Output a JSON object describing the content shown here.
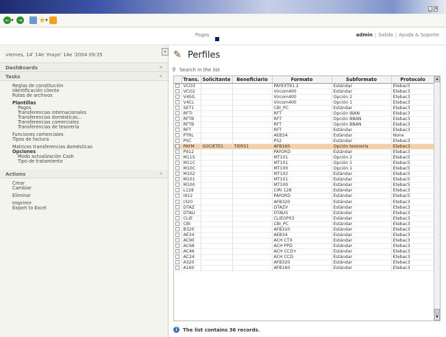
{
  "window": {
    "controls": [
      "_",
      "×"
    ]
  },
  "toolbar": {
    "icons": [
      "back-icon",
      "forward-icon",
      "page-icon",
      "favorites-star-icon",
      "home-icon"
    ]
  },
  "header": {
    "nav_item": "Pagos",
    "user": "admin",
    "links": [
      "Salida",
      "Ayuda & Soporte"
    ]
  },
  "sidebar": {
    "date": "viernes, 14' 14e 'mayo' 14e '2004 09:35",
    "collapse_label": "«",
    "dashboards_title": "DashBoards",
    "tasks_title": "Tasks",
    "tasks": {
      "reglas": "Reglas de constitución",
      "identificacion": "Identificación cliente",
      "rutas": "Rutas de archivos",
      "plantillas": "Plantillas",
      "pagos": "Pagos",
      "transf_int": "Transferencias internacionales",
      "transf_dom": "Transferencias domésticas...",
      "transf_com": "Transferencias comerciales",
      "transf_tes": "Transferencias de tesorería",
      "funciones": "Funciones comerciales",
      "tipos_factura": "Tipos de factura",
      "matrices": "Matrices transferencias domésticas",
      "opciones": "Opciones",
      "modo_cash": "Modo actualización Cash",
      "tipo_tratamiento": "Tipo de tratamiento"
    },
    "actions_title": "Actions",
    "actions": {
      "crear": "Crear",
      "cambiar": "Cambiar",
      "eliminar": "Eliminar",
      "imprimir": "Imprimir",
      "export": "Export to Excel"
    }
  },
  "main": {
    "title": "Perfiles",
    "search_label": "Search in the list",
    "columns": [
      "Trans.",
      "Solicitante",
      "Beneficiario",
      "Formato",
      "Subformato",
      "Protocolo"
    ],
    "rows": [
      [
        "VCO3",
        "",
        "",
        "PAYEXT91.2",
        "Estándar",
        "Etebac5"
      ],
      [
        "VCO2",
        "",
        "",
        "Vircom400",
        "Estándar",
        "Etebac3"
      ],
      [
        "V4SG",
        "",
        "",
        "Vircom400",
        "Opción 2",
        "Etebac3"
      ],
      [
        "V4CL",
        "",
        "",
        "Vircom400",
        "Opción 1",
        "Etebac3"
      ],
      [
        "SET1",
        "",
        "",
        "CBI_PC",
        "Estándar",
        "Etebac3"
      ],
      [
        "RFTI",
        "",
        "",
        "RFT",
        "Opción IBAN",
        "Etebac3"
      ],
      [
        "RFTB",
        "",
        "",
        "RFT",
        "Opción BBAN",
        "Etebac3"
      ],
      [
        "RFTB",
        "",
        "",
        "RFT",
        "Opción BBAN",
        "Etebac3"
      ],
      [
        "RFT",
        "",
        "",
        "RFT",
        "Estándar",
        "Etebac3"
      ],
      [
        "PTRL",
        "",
        "",
        "AEB34",
        "Estándar",
        "None"
      ],
      [
        "PSC",
        "",
        "",
        "PS2",
        "Estándar",
        "Etebac3"
      ],
      [
        "PAYM",
        "SOCIETE1",
        "TIERS1",
        "AFB160",
        "Opción tesorería",
        "Etebac3"
      ],
      [
        "P912",
        "",
        "",
        "PAYORD",
        "Estándar",
        "Etebac3"
      ],
      [
        "M11S",
        "",
        "",
        "MT101",
        "Opción 2",
        "Etebac5"
      ],
      [
        "M11C",
        "",
        "",
        "MT101",
        "Opción 1",
        "Etebac5"
      ],
      [
        "M10C",
        "",
        "",
        "MT100",
        "Opción 1",
        "Etebac5"
      ],
      [
        "M102",
        "",
        "",
        "MT102",
        "Estándar",
        "Etebac5"
      ],
      [
        "M101",
        "",
        "",
        "MT101",
        "Estándar",
        "Etebac5"
      ],
      [
        "M100",
        "",
        "",
        "MT100",
        "Estándar",
        "Etebac5"
      ],
      [
        "L128",
        "",
        "",
        "CIRI 128",
        "Estándar",
        "Etebac3"
      ],
      [
        "I912",
        "",
        "",
        "PAYORD",
        "Estándar",
        "Etebac5"
      ],
      [
        "I320",
        "",
        "",
        "AFB320",
        "Estándar",
        "Etebac3"
      ],
      [
        "DTAZ",
        "",
        "",
        "DTAZV",
        "Estándar",
        "Etebac3"
      ],
      [
        "DTAU",
        "",
        "",
        "DTAUS",
        "Estándar",
        "Etebac3"
      ],
      [
        "CLIE",
        "",
        "",
        "CLIEOP03",
        "Estándar",
        "Etebac3"
      ],
      [
        "CBI",
        "",
        "",
        "CBI_PC",
        "Estándar",
        "Etebac3"
      ],
      [
        "B320",
        "",
        "",
        "AFB320",
        "Estándar",
        "Etebac3"
      ],
      [
        "AE34",
        "",
        "",
        "AEB34",
        "Estándar",
        "Etebac3"
      ],
      [
        "AC90",
        "",
        "",
        "ACH CTX",
        "Estándar",
        "Etebac3"
      ],
      [
        "AC68",
        "",
        "",
        "ACH PPD",
        "Estándar",
        "Etebac3"
      ],
      [
        "AC46",
        "",
        "",
        "ACH CCD+",
        "Estándar",
        "Etebac3"
      ],
      [
        "AC24",
        "",
        "",
        "ACH CCD",
        "Estándar",
        "Etebac3"
      ],
      [
        "A320",
        "",
        "",
        "AFB320",
        "Estándar",
        "Etebac3"
      ],
      [
        "A160",
        "",
        "",
        "AFB160",
        "Estándar",
        "Etebac3"
      ]
    ],
    "selected_row": 11,
    "footer": "The list contains  36 records.",
    "colors": {
      "selected_row": "#f7cfa6",
      "header_gradient_dark": "#1e2c6e"
    }
  }
}
